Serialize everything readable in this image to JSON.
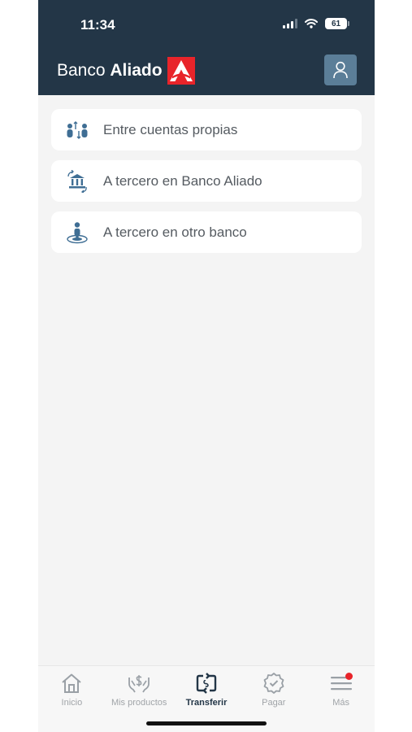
{
  "status_bar": {
    "time": "11:34",
    "battery": "61"
  },
  "header": {
    "brand_regular": "Banco ",
    "brand_bold": "Aliado",
    "logo_color": "#e8242a",
    "background": "#233647",
    "profile_icon": "user-icon"
  },
  "menu": {
    "items": [
      {
        "label": "Entre cuentas propias",
        "icon": "people-transfer-icon"
      },
      {
        "label": "A tercero en Banco Aliado",
        "icon": "bank-transfer-icon"
      },
      {
        "label": "A tercero en otro banco",
        "icon": "person-location-icon"
      }
    ]
  },
  "tabbar": {
    "active": "Transferir",
    "items": [
      {
        "label": "Inicio",
        "icon": "home-icon"
      },
      {
        "label": "Mis productos",
        "icon": "hands-money-icon"
      },
      {
        "label": "Transferir",
        "icon": "transfer-icon"
      },
      {
        "label": "Pagar",
        "icon": "badge-check-icon"
      },
      {
        "label": "Más",
        "icon": "hamburger-menu-icon"
      }
    ]
  }
}
